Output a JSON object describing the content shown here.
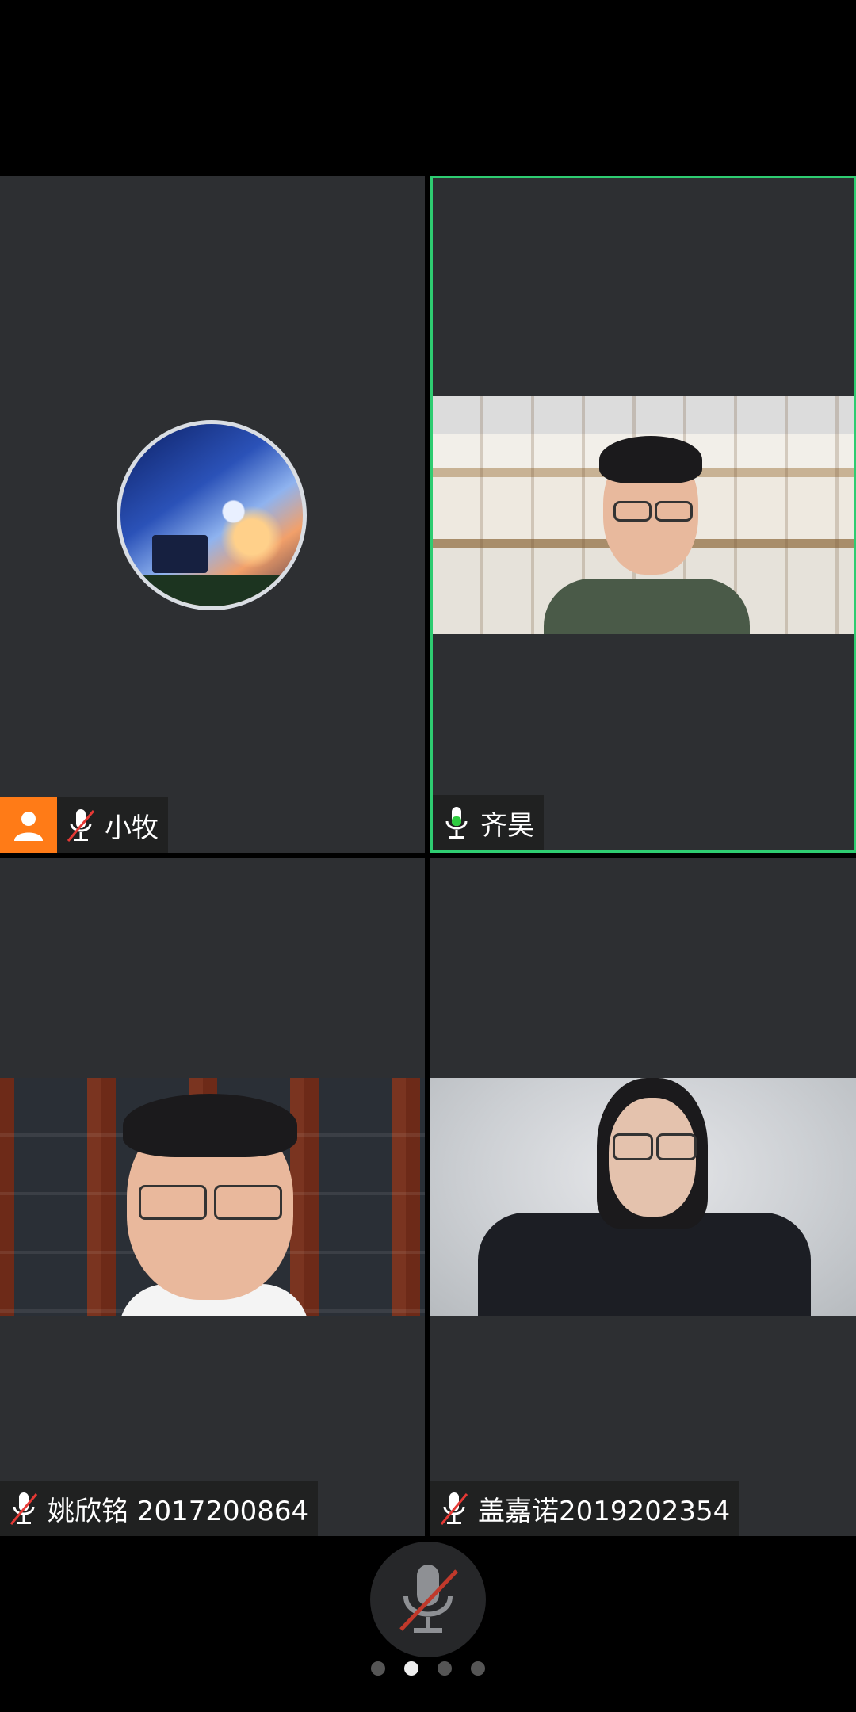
{
  "participants": [
    {
      "name": "小牧",
      "mic": "muted",
      "is_host": true,
      "view": "avatar",
      "avatar": "anime-girl-piano-avatar"
    },
    {
      "name": "齐昊",
      "mic": "active",
      "is_host": false,
      "view": "video",
      "active_speaker": true
    },
    {
      "name": "姚欣铭 2017200864",
      "mic": "muted",
      "is_host": false,
      "view": "video"
    },
    {
      "name": "盖嘉诺2019202354",
      "mic": "muted",
      "is_host": false,
      "view": "video"
    }
  ],
  "controls": {
    "main_mic": "muted",
    "mic_icon": "microphone-muted-icon"
  },
  "pagination": {
    "total": 4,
    "current": 2
  },
  "colors": {
    "active_border": "#2ecc71",
    "host_badge": "#ff7b17",
    "mute_slash": "#e53935",
    "mic_active": "#2ecc40",
    "tile_bg": "#2d2f32"
  }
}
